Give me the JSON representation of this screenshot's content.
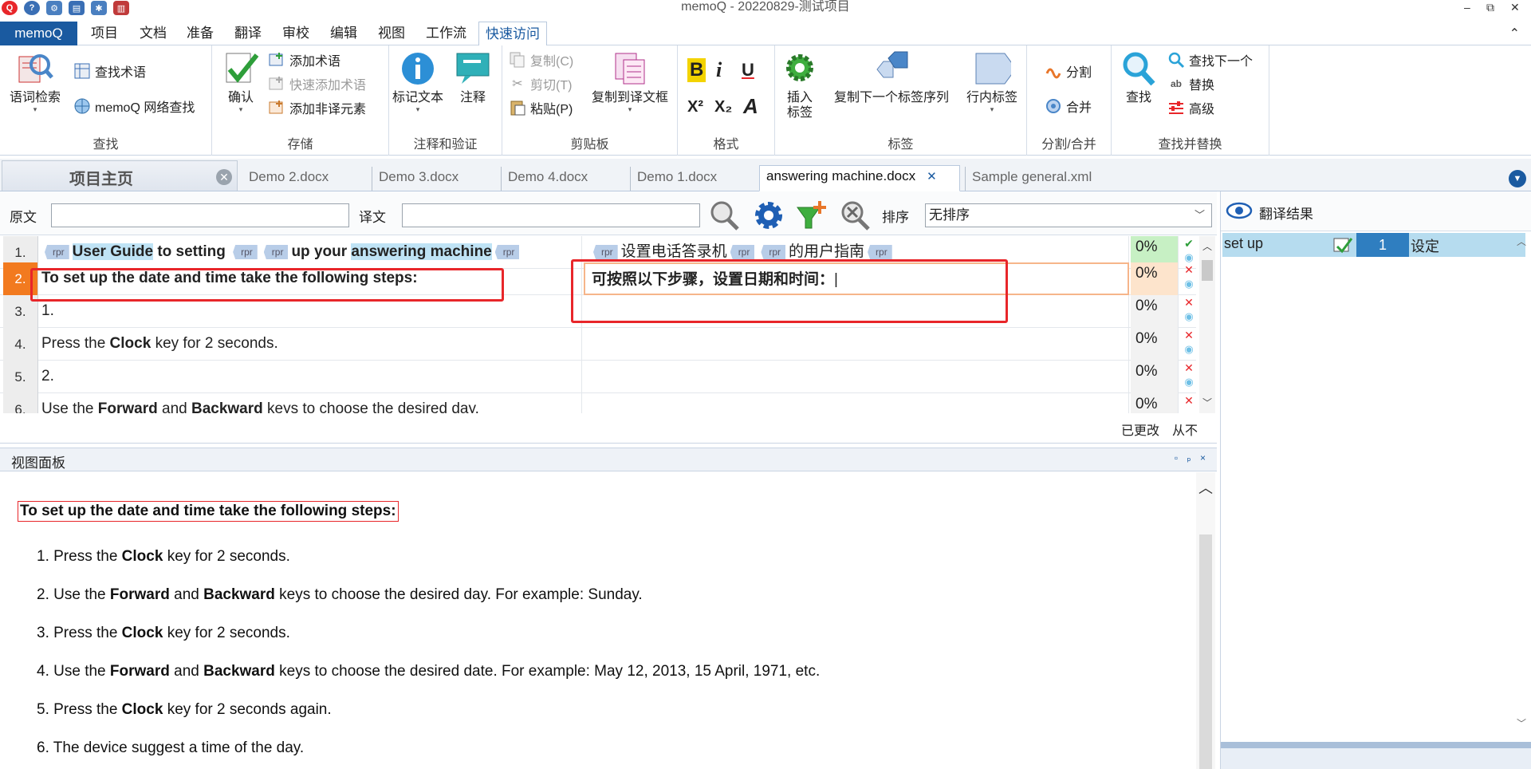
{
  "window": {
    "title": "memoQ - 20220829-测试项目",
    "minimize": "–",
    "restore": "⧉",
    "close": "✕"
  },
  "menu": {
    "app": "memoQ",
    "tabs": [
      "项目",
      "文档",
      "准备",
      "翻译",
      "审校",
      "编辑",
      "视图",
      "工作流",
      "快速访问"
    ],
    "active_tab": "快速访问"
  },
  "ribbon": {
    "find_group": {
      "label": "查找",
      "term_search": "语词检索",
      "find_term": "查找术语",
      "web_search": "memoQ 网络查找"
    },
    "store_group": {
      "label": "存储",
      "confirm": "确认",
      "add_term": "添加术语",
      "quick_add_term": "快速添加术语",
      "add_nontranslatable": "添加非译元素"
    },
    "comment_group": {
      "label": "注释和验证",
      "mark_text": "标记文本",
      "comment": "注释"
    },
    "clipboard_group": {
      "label": "剪贴板",
      "copy": "复制(C)",
      "cut": "剪切(T)",
      "paste": "粘贴(P)",
      "copy_to_target": "复制到译文框"
    },
    "format_group": {
      "label": "格式",
      "bold": "B",
      "italic": "i",
      "underline": "U",
      "superscript": "X²",
      "subscript": "X₂",
      "font": "A"
    },
    "tags_group": {
      "label": "标签",
      "insert_tag_line1": "插入",
      "insert_tag_line2": "标签",
      "copy_next_tag": "复制下一个标签序列",
      "inline_tag": "行内标签"
    },
    "split_group": {
      "label": "分割/合并",
      "split": "分割",
      "join": "合并"
    },
    "findreplace_group": {
      "label": "查找并替换",
      "find": "查找",
      "find_next": "查找下一个",
      "replace": "替换",
      "advanced": "高级"
    }
  },
  "doc_tabs": {
    "home": "项目主页",
    "tabs": [
      "Demo 2.docx",
      "Demo 3.docx",
      "Demo 4.docx",
      "Demo 1.docx",
      "answering machine.docx",
      "Sample general.xml"
    ],
    "active": "answering machine.docx"
  },
  "filter": {
    "source_label": "原文",
    "target_label": "译文",
    "source_value": "",
    "target_value": "",
    "sort_label": "排序",
    "sort_value": "无排序"
  },
  "grid": {
    "rows": [
      {
        "num": "1.",
        "pct": "0%"
      },
      {
        "num": "2.",
        "pct": "0%",
        "src": "To set up the date and time take the following steps:",
        "tgt": "可按照以下步骤，设置日期和时间："
      },
      {
        "num": "3.",
        "pct": "0%",
        "src": "1."
      },
      {
        "num": "4.",
        "pct": "0%",
        "src_a": "Press the ",
        "src_b": "Clock",
        "src_c": " key for 2 seconds."
      },
      {
        "num": "5.",
        "pct": "0%",
        "src": "2."
      },
      {
        "num": "6.",
        "pct": "0%",
        "src_a": "Use the ",
        "src_b": "Forward",
        "src_c": " and ",
        "src_d": "Backward",
        "src_e": " keys to choose the desired day."
      }
    ],
    "row1_src": {
      "p1": "User Guide",
      "p2": " to setting ",
      "p3": "up your ",
      "p4": "answering machine"
    },
    "row1_tgt": {
      "p1": "设置电话答录机",
      "p2": "的用户指南"
    },
    "tag_label": "rpr",
    "footer_changed": "已更改",
    "footer_from": "从不"
  },
  "view_panel": {
    "title": "视图面板",
    "controls": "▫ ₚ ×",
    "heading": "To set up the date and time take the following steps:",
    "items": [
      {
        "n": "1. ",
        "a": "Press the ",
        "b": "Clock",
        "c": " key for 2 seconds.",
        "d": "",
        "e": ""
      },
      {
        "n": "2. ",
        "a": "Use the ",
        "b": "Forward",
        "c": " and ",
        "d": "Backward",
        "e": " keys to choose the desired day. For example: Sunday."
      },
      {
        "n": "3. ",
        "a": "Press the ",
        "b": "Clock",
        "c": " key for 2 seconds.",
        "d": "",
        "e": ""
      },
      {
        "n": "4. ",
        "a": "Use the ",
        "b": "Forward",
        "c": " and ",
        "d": "Backward",
        "e": " keys to choose the desired date. For example: May 12, 2013, 15 April, 1971, etc."
      },
      {
        "n": "5. ",
        "a": "Press the ",
        "b": "Clock",
        "c": " key for 2 seconds again.",
        "d": "",
        "e": ""
      },
      {
        "n": "6. ",
        "a": "The device suggest a time of the day.",
        "b": "",
        "c": "",
        "d": "",
        "e": ""
      }
    ]
  },
  "results": {
    "title": "翻译结果",
    "term_source": "set up",
    "term_index": "1",
    "term_target": "设定"
  }
}
